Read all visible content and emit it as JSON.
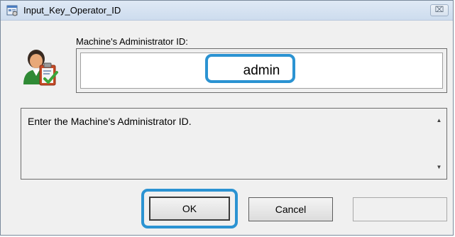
{
  "window": {
    "title": "Input_Key_Operator_ID",
    "close_label": "⌧"
  },
  "form": {
    "field_label": "Machine's Administrator ID:",
    "id_value": "admin"
  },
  "message": {
    "text": "Enter the Machine's Administrator ID."
  },
  "buttons": {
    "ok_label": "OK",
    "cancel_label": "Cancel",
    "blank_label": ""
  },
  "icons": {
    "title": "window-app-icon",
    "avatar": "administrator-clipboard-icon",
    "scroll_up": "scroll-up-arrow-icon",
    "scroll_down": "scroll-down-arrow-icon"
  },
  "colors": {
    "highlight": "#2b93d2",
    "titlebar": "#dfe9f5",
    "dialog_bg": "#f0f0f0"
  }
}
